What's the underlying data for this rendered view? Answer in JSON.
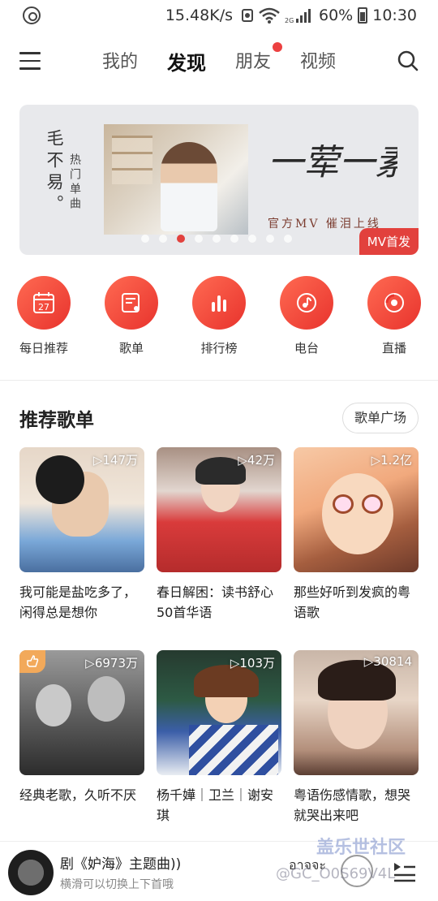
{
  "status_bar": {
    "speed": "15.48K/s",
    "battery_pct": "60%",
    "time": "10:30",
    "network": "2G"
  },
  "nav": {
    "tabs": [
      {
        "label": "我的"
      },
      {
        "label": "发现"
      },
      {
        "label": "朋友"
      },
      {
        "label": "视频"
      }
    ],
    "active_tab": "发现"
  },
  "banner": {
    "title_vertical": "毛不易。",
    "subtitle_vertical": "热门单曲",
    "calligraphy": "一荤一素",
    "caption": "官方MV 催泪上线",
    "tag": "MV首发",
    "page_count": 9,
    "active_page": 3
  },
  "categories": [
    {
      "label": "每日推荐",
      "icon": "calendar-icon",
      "day": "27"
    },
    {
      "label": "歌单",
      "icon": "playlist-icon"
    },
    {
      "label": "排行榜",
      "icon": "chart-icon"
    },
    {
      "label": "电台",
      "icon": "radio-icon"
    },
    {
      "label": "直播",
      "icon": "live-icon"
    }
  ],
  "section": {
    "title": "推荐歌单",
    "more_button": "歌单广场"
  },
  "playlists": [
    {
      "plays": "▷147万",
      "name": "我可能是盐吃多了，闲得总是想你"
    },
    {
      "plays": "▷42万",
      "name": "春日解困：读书舒心50首华语"
    },
    {
      "plays": "▷1.2亿",
      "name": "那些好听到发疯的粤语歌"
    },
    {
      "plays": "▷6973万",
      "name": "经典老歌，久听不厌"
    },
    {
      "plays": "▷103万",
      "name": "杨千嬅｜卫兰｜谢安琪"
    },
    {
      "plays": "▷30814",
      "name": "粤语伤感情歌，想哭就哭出来吧"
    }
  ],
  "player": {
    "song": "剧《妒海》主题曲))",
    "hint": "横滑可以切换上下首哦",
    "next_text": "อาจจะ"
  },
  "watermark": {
    "line1": "盖乐世社区",
    "line2": "@GC_O0S69V4L"
  },
  "colors": {
    "accent": "#e8332d",
    "badge": "#f2a95a"
  }
}
